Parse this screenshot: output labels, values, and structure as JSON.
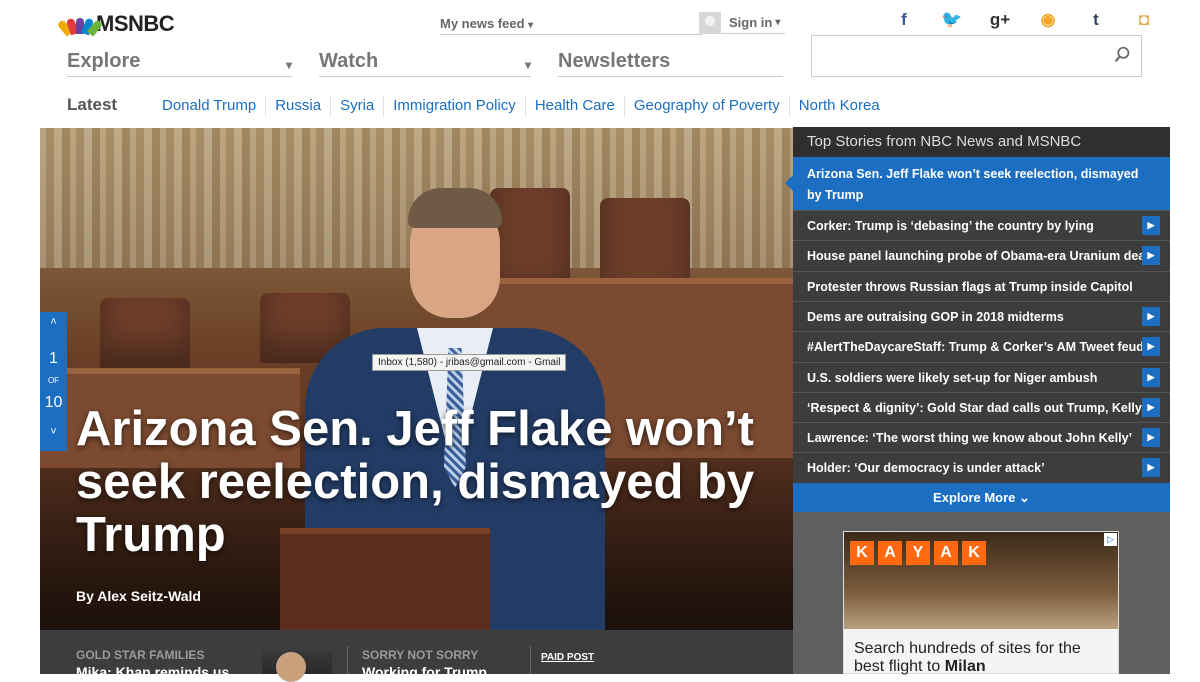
{
  "header": {
    "logo_text": "MSNBC",
    "news_feed": "My news feed",
    "sign_in": "Sign in",
    "social_icons": [
      "facebook-icon",
      "twitter-icon",
      "google-plus-icon",
      "rss-icon",
      "tumblr-icon",
      "instagram-icon"
    ],
    "social_glyphs": [
      "f",
      "🐦",
      "g+",
      "◉",
      "t",
      "◘"
    ],
    "social_colors": [
      "#3b5998",
      "#1da1f2",
      "#333333",
      "#f5a623",
      "#35465c",
      "#e7a552"
    ]
  },
  "nav": {
    "explore": "Explore",
    "watch": "Watch",
    "newsletters": "Newsletters",
    "chevron": "⌄"
  },
  "search": {
    "placeholder": ""
  },
  "latest": {
    "label": "Latest",
    "topics": [
      "Donald Trump",
      "Russia",
      "Syria",
      "Immigration Policy",
      "Health Care",
      "Geography of Poverty",
      "North Korea"
    ]
  },
  "hero": {
    "headline": "Arizona Sen. Jeff Flake won’t seek reelection, dismayed by Trump",
    "byline": "By Alex Seitz-Wald",
    "tooltip": "Inbox (1,580) - jribas@gmail.com - Gmail",
    "pager": {
      "current": "1",
      "of": "OF",
      "total": "10"
    }
  },
  "top_stories": {
    "title": "Top Stories from NBC News and MSNBC",
    "active": "Arizona Sen. Jeff Flake won’t seek reelection, dismayed by Trump",
    "items": [
      {
        "text": "Corker: Trump is ‘debasing’ the country by lying",
        "video": true
      },
      {
        "text": "House panel launching probe of Obama-era Uranium deal",
        "video": true
      },
      {
        "text": "Protester throws Russian flags at Trump inside Capitol",
        "video": false
      },
      {
        "text": "Dems are outraising GOP in 2018 midterms",
        "video": true
      },
      {
        "text": "#AlertTheDaycareStaff: Trump & Corker’s AM Tweet feud",
        "video": true
      },
      {
        "text": "U.S. soldiers were likely set-up for Niger ambush",
        "video": true
      },
      {
        "text": "‘Respect & dignity’: Gold Star dad calls out Trump, Kelly",
        "video": true
      },
      {
        "text": "Lawrence: ‘The worst thing we know about John Kelly’",
        "video": true
      },
      {
        "text": "Holder: ‘Our democracy is under attack’",
        "video": true
      }
    ],
    "play_glyph": "▶",
    "explore_more": "Explore More"
  },
  "ad": {
    "brand_letters": [
      "K",
      "A",
      "Y",
      "A",
      "K"
    ],
    "text": "Search hundreds of sites for the best flight to",
    "city": "Milan"
  },
  "strip": {
    "col1_kicker": "GOLD STAR FAMILIES",
    "col1_title": "Mika: Khan reminds us",
    "col2_kicker": "SORRY NOT SORRY",
    "col2_title": "Working for Trump",
    "col3_kicker": "PAID POST"
  },
  "colors": {
    "accent": "#1b6ec2",
    "panel": "#3d3d3d"
  }
}
